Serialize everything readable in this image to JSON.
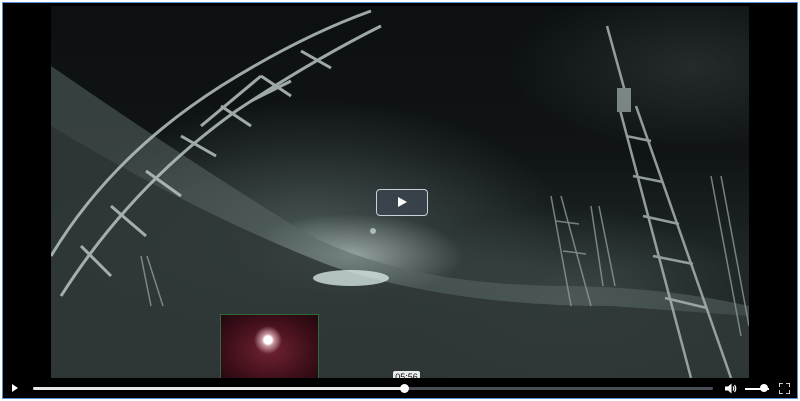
{
  "player": {
    "current_time_tooltip": "05:56",
    "progress_fraction": 0.545,
    "volume_fraction": 0.9
  },
  "icons": {
    "big_play": "play-icon",
    "play": "play-icon",
    "volume": "volume-icon",
    "fullscreen": "fullscreen-icon"
  },
  "colors": {
    "frame_border": "#5a8fd0",
    "preview_border": "#2f6a38"
  }
}
